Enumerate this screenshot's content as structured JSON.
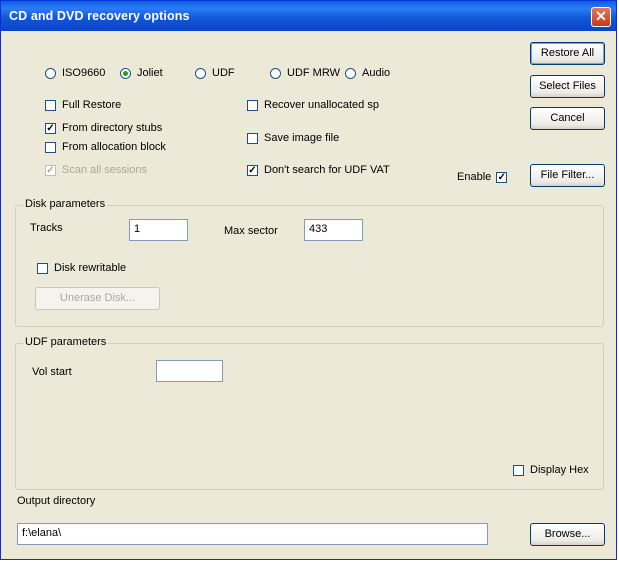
{
  "window": {
    "title": "CD and DVD recovery options",
    "close_label": "✕"
  },
  "format_radios": [
    {
      "label": "ISO9660",
      "selected": false
    },
    {
      "label": "Joliet",
      "selected": true
    },
    {
      "label": "UDF",
      "selected": false
    },
    {
      "label": "UDF MRW",
      "selected": false
    },
    {
      "label": "Audio",
      "selected": false
    }
  ],
  "options": {
    "full_restore": {
      "label": "Full Restore",
      "checked": false
    },
    "from_directory_stubs": {
      "label": "From directory stubs",
      "checked": true
    },
    "from_allocation_block": {
      "label": "From allocation block",
      "checked": false
    },
    "scan_all_sessions": {
      "label": "Scan all sessions",
      "checked": true,
      "disabled": true
    },
    "recover_unallocated": {
      "label": "Recover unallocated sp",
      "checked": false
    },
    "save_image_file": {
      "label": "Save image file",
      "checked": false
    },
    "dont_search_udf_vat": {
      "label": "Don't search for UDF VAT",
      "checked": true
    },
    "enable": {
      "label": "Enable",
      "checked": true
    }
  },
  "buttons": {
    "restore_all": "Restore All",
    "select_files": "Select Files",
    "cancel": "Cancel",
    "file_filter": "File Filter...",
    "unerase_disk": "Unerase Disk...",
    "browse": "Browse..."
  },
  "disk_parameters": {
    "group_label": "Disk parameters",
    "tracks_label": "Tracks",
    "tracks_value": "1",
    "max_sector_label": "Max sector",
    "max_sector_value": "433",
    "disk_rewritable": {
      "label": "Disk rewritable",
      "checked": false
    }
  },
  "udf_parameters": {
    "group_label": "UDF parameters",
    "vol_start_label": "Vol start",
    "vol_start_value": "",
    "display_hex": {
      "label": "Display Hex",
      "checked": false
    }
  },
  "output": {
    "label": "Output directory",
    "value": "f:\\elana\\"
  },
  "icons": {
    "check": "✓"
  }
}
